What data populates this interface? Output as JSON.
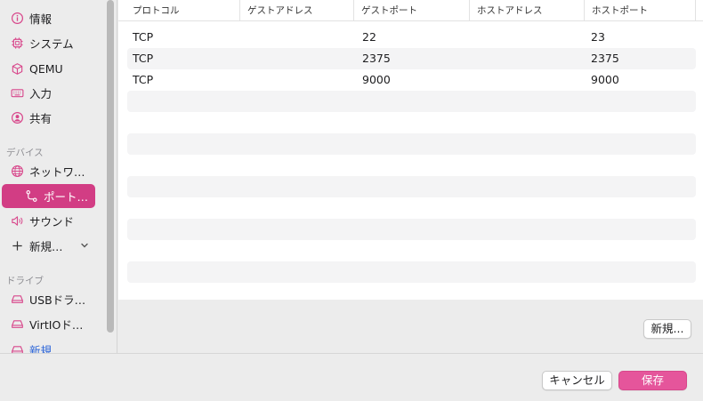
{
  "sidebar": {
    "items": [
      {
        "label": "情報",
        "icon": "info-icon"
      },
      {
        "label": "システム",
        "icon": "cpu-icon"
      },
      {
        "label": "QEMU",
        "icon": "cube-icon"
      },
      {
        "label": "入力",
        "icon": "keyboard-icon"
      },
      {
        "label": "共有",
        "icon": "person-icon"
      }
    ],
    "devices_header": "デバイス",
    "devices": [
      {
        "label": "ネットワ…",
        "icon": "globe-icon"
      },
      {
        "label": "ポート…",
        "icon": "port-icon",
        "selected": true
      },
      {
        "label": "サウンド",
        "icon": "speaker-icon"
      },
      {
        "label": "新規…",
        "icon": "plus-icon"
      }
    ],
    "drives_header": "ドライブ",
    "drives": [
      {
        "label": "USBドラ…",
        "icon": "drive-icon"
      },
      {
        "label": "VirtIOド…",
        "icon": "drive-icon"
      },
      {
        "label": "新規…",
        "icon": "drive-icon"
      }
    ]
  },
  "table": {
    "columns": [
      "プロトコル",
      "ゲストアドレス",
      "ゲストポート",
      "ホストアドレス",
      "ホストポート"
    ],
    "rows": [
      {
        "protocol": "TCP",
        "guest_address": "",
        "guest_port": "22",
        "host_address": "",
        "host_port": "23"
      },
      {
        "protocol": "TCP",
        "guest_address": "",
        "guest_port": "2375",
        "host_address": "",
        "host_port": "2375"
      },
      {
        "protocol": "TCP",
        "guest_address": "",
        "guest_port": "9000",
        "host_address": "",
        "host_port": "9000"
      }
    ]
  },
  "actions": {
    "new_label": "新規...",
    "cancel_label": "キャンセル",
    "save_label": "保存"
  },
  "colors": {
    "accent": "#d23d84",
    "primary_button": "#e5559b",
    "link": "#2a63d8"
  }
}
